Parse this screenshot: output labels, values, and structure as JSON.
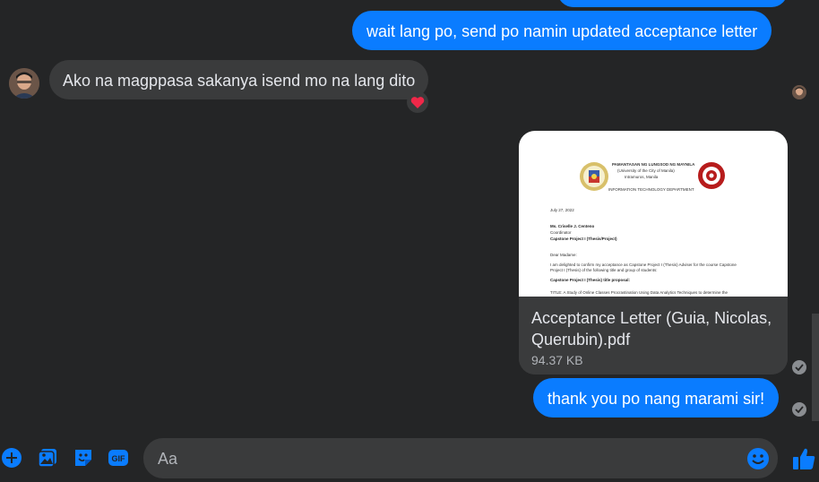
{
  "messages": {
    "outgoing_top": "wait lang po, send po namin updated acceptance letter",
    "incoming": "Ako na magppasa sakanya isend mo na lang dito",
    "reaction_icon": "heart-icon",
    "outgoing_bottom": "thank you po nang marami sir!"
  },
  "attachment": {
    "file_name": "Acceptance Letter (Guia, Nicolas, Querubin).pdf",
    "file_size": "94.37 KB",
    "preview": {
      "university": "PAMANTASAN NG LUNGSOD NG MAYNILA",
      "university_en": "(University of the City of Manila)",
      "location": "Intramuros, Manila",
      "department": "INFORMATION TECHNOLOGY DEPARTMENT",
      "date": "July 27, 2022",
      "recipient": "Ms. Criselle J. Centeno",
      "recipient_role": "Coordinator",
      "recipient_course": "Capstone Project I (Thesis/Project)",
      "salutation": "Dear Madame:",
      "body_1": "I am delighted to confirm my acceptance as Capstone Project I (Thesis) Adviser for the course Capstone",
      "body_2": "Project I (Thesis) of the following title and group of students:",
      "proposal_heading": "Capstone Project I (Thesis) title proposal:",
      "title_line": "TITLE: A Study of Online Classes Procrastination Using Data Analytics Techniques to determine the"
    }
  },
  "composer": {
    "placeholder": "Aa"
  },
  "colors": {
    "background": "#242526",
    "outgoing_bubble": "#0a7cff",
    "incoming_bubble": "#3a3b3c",
    "accent": "#0a7cff"
  }
}
